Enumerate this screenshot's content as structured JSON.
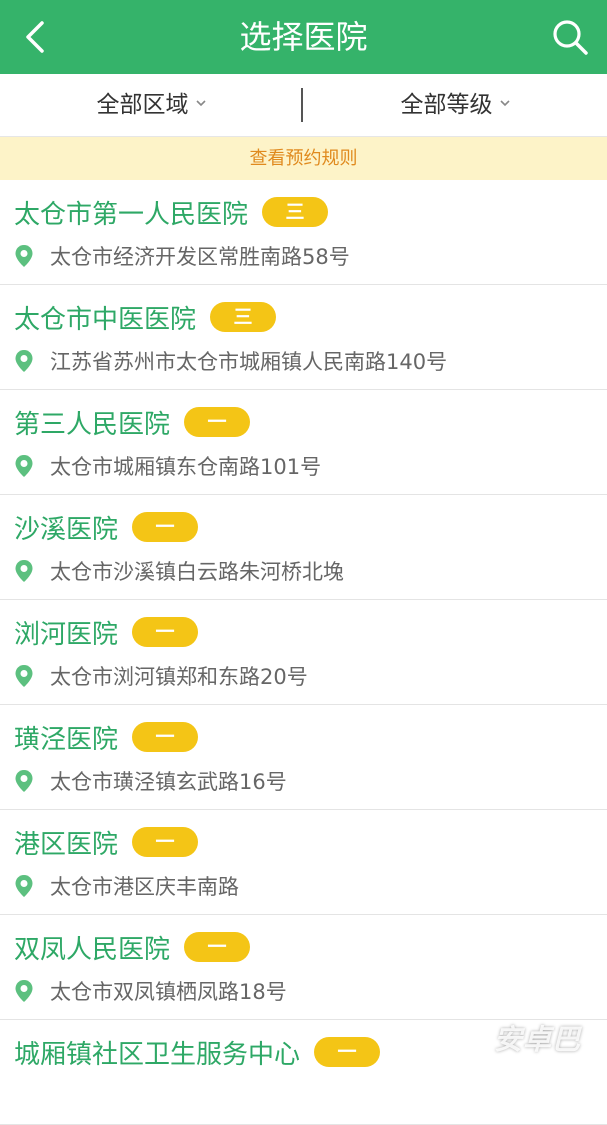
{
  "header": {
    "title": "选择医院",
    "back_icon": "chevron-left-icon",
    "search_icon": "search-icon",
    "background_color": "#35b36a"
  },
  "filters": {
    "area_label": "全部区域",
    "level_label": "全部等级"
  },
  "notice": {
    "text": "查看预约规则",
    "background_color": "#fdf3c8",
    "text_color": "#e08a1e"
  },
  "colors": {
    "hospital_name": "#2ea866",
    "badge": "#f4c516",
    "pin": "#5cc07f"
  },
  "hospitals": [
    {
      "name": "太仓市第一人民医院",
      "level": "三",
      "address": "太仓市经济开发区常胜南路58号"
    },
    {
      "name": "太仓市中医医院",
      "level": "三",
      "address": "江苏省苏州市太仓市城厢镇人民南路140号"
    },
    {
      "name": "第三人民医院",
      "level": "一",
      "address": "太仓市城厢镇东仓南路101号"
    },
    {
      "name": "沙溪医院",
      "level": "一",
      "address": "太仓市沙溪镇白云路朱河桥北堍"
    },
    {
      "name": "浏河医院",
      "level": "一",
      "address": "太仓市浏河镇郑和东路20号"
    },
    {
      "name": "璜泾医院",
      "level": "一",
      "address": "太仓市璜泾镇玄武路16号"
    },
    {
      "name": "港区医院",
      "level": "一",
      "address": "太仓市港区庆丰南路"
    },
    {
      "name": "双凤人民医院",
      "level": "一",
      "address": "太仓市双凤镇栖凤路18号"
    },
    {
      "name": "城厢镇社区卫生服务中心",
      "level": "一",
      "address": ""
    }
  ],
  "watermark": "安卓巴"
}
